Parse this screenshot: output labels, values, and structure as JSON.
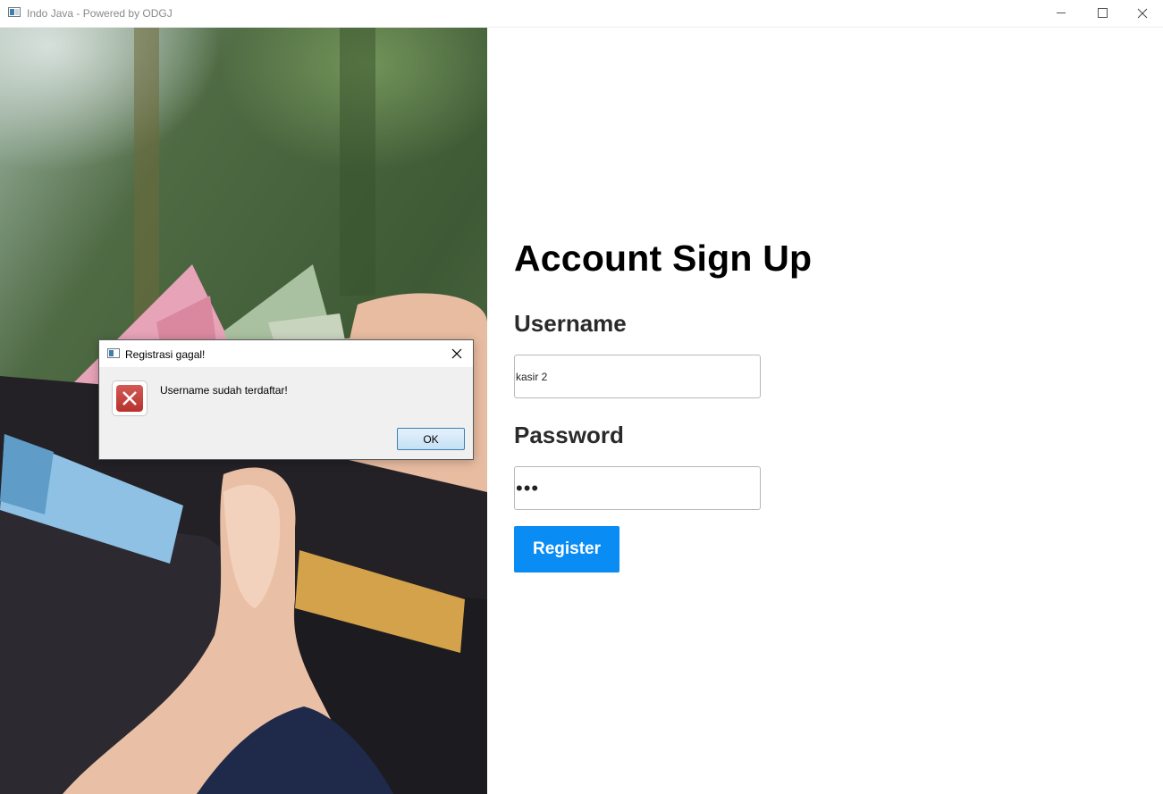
{
  "window": {
    "title": "Indo Java - Powered by ODGJ",
    "icon": "app-window-icon",
    "controls": [
      "minimize-icon",
      "maximize-icon",
      "close-icon"
    ]
  },
  "form": {
    "title": "Account Sign Up",
    "username_label": "Username",
    "username_value": "kasir 2",
    "password_label": "Password",
    "password_masked": "•••",
    "register_label": "Register"
  },
  "dialog": {
    "title": "Registrasi gagal!",
    "message": "Username sudah terdaftar!",
    "ok_label": "OK",
    "icon": "error-icon"
  },
  "colors": {
    "register_button": "#0a8cf5",
    "error_icon": "#c0403a"
  }
}
